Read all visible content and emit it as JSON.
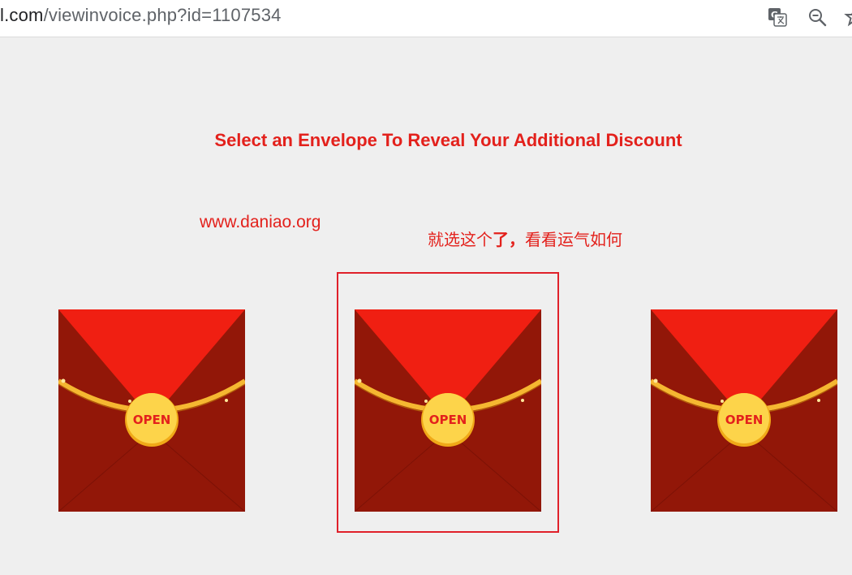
{
  "browser": {
    "url_domain": "l.com",
    "url_path": "/viewinvoice.php?id=1107534"
  },
  "page": {
    "headline": "Select an Envelope To Reveal Your Additional Discount",
    "watermark": "www.daniao.org",
    "note_part1": "就选这个",
    "note_bold": "了，",
    "note_part2": "看看运气如何"
  },
  "envelopes": [
    {
      "label": "OPEN"
    },
    {
      "label": "OPEN"
    },
    {
      "label": "OPEN"
    }
  ],
  "colors": {
    "accent_red": "#e3211c",
    "envelope_dark": "#921708",
    "envelope_flap": "#f01f12",
    "seal_gold": "#fdd44a"
  }
}
